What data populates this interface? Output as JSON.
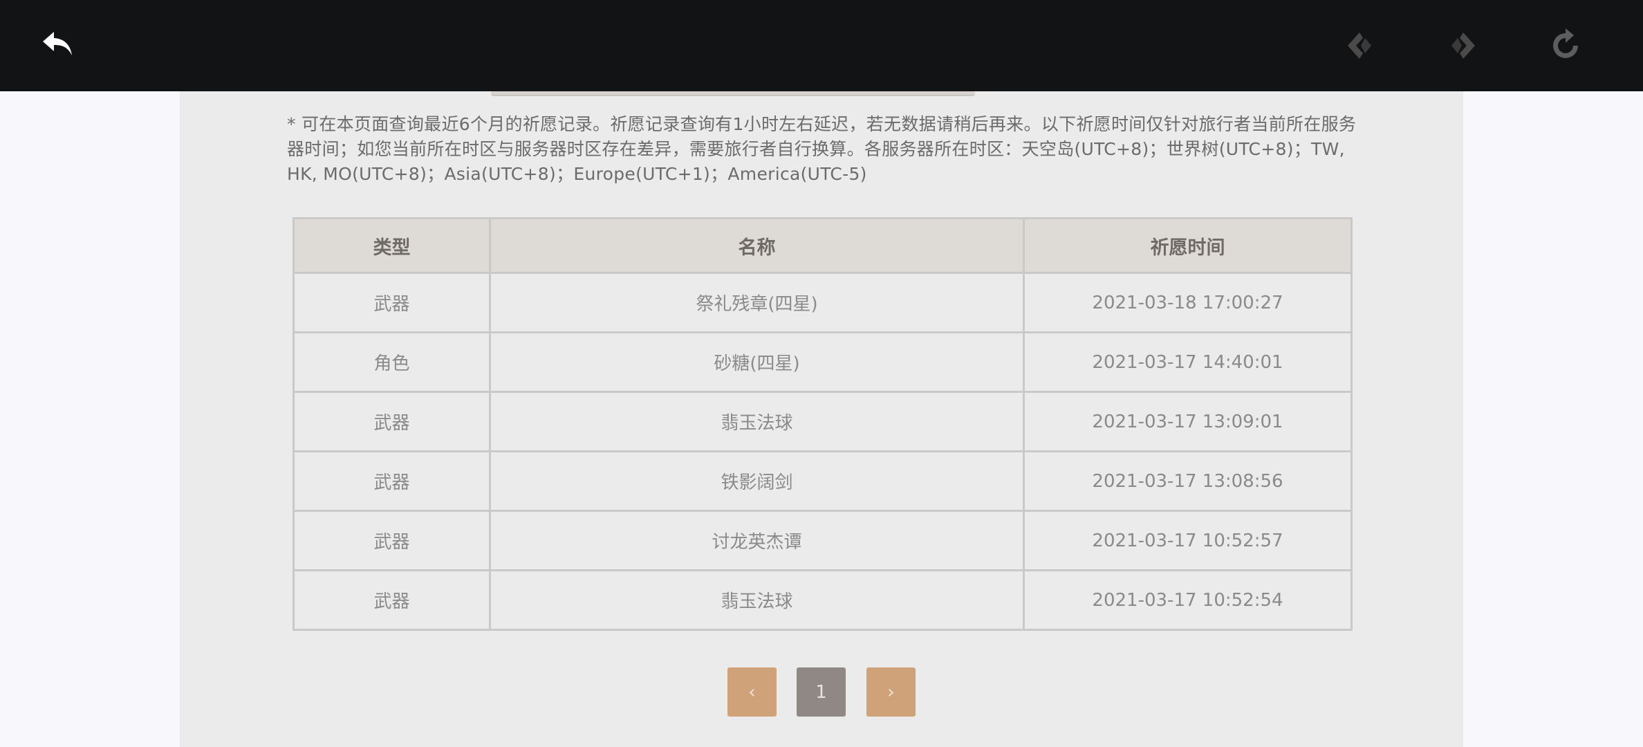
{
  "browser": {
    "icons": [
      "back-arrow-icon",
      "nav-prev-icon",
      "nav-next-icon",
      "reload-icon"
    ]
  },
  "notice": "* 可在本页面查询最近6个月的祈愿记录。祈愿记录查询有1小时左右延迟，若无数据请稍后再来。以下祈愿时间仅针对旅行者当前所在服务器时间；如您当前所在时区与服务器时区存在差异，需要旅行者自行换算。各服务器所在时区：天空岛(UTC+8)；世界树(UTC+8)；TW, HK, MO(UTC+8)；Asia(UTC+8)；Europe(UTC+1)；America(UTC-5)",
  "table": {
    "headers": [
      "类型",
      "名称",
      "祈愿时间"
    ],
    "rows": [
      {
        "type": "武器",
        "name": "祭礼残章(四星)",
        "time": "2021-03-18 17:00:27"
      },
      {
        "type": "角色",
        "name": "砂糖(四星)",
        "time": "2021-03-17 14:40:01"
      },
      {
        "type": "武器",
        "name": "翡玉法球",
        "time": "2021-03-17 13:09:01"
      },
      {
        "type": "武器",
        "name": "铁影阔剑",
        "time": "2021-03-17 13:08:56"
      },
      {
        "type": "武器",
        "name": "讨龙英杰谭",
        "time": "2021-03-17 10:52:57"
      },
      {
        "type": "武器",
        "name": "翡玉法球",
        "time": "2021-03-17 10:52:54"
      }
    ]
  },
  "pagination": {
    "prev": "‹",
    "current": "1",
    "next": "›"
  },
  "colors": {
    "topbar": "#121315",
    "page_bg": "#ebebeb",
    "four_star_name": "#a469d6",
    "pager_button": "#cfa27a",
    "pager_current": "#8f8884"
  }
}
